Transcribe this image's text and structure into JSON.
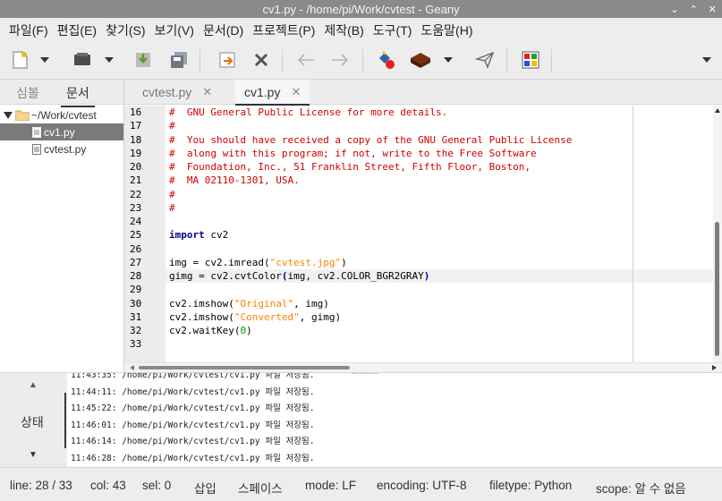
{
  "window": {
    "title": "cv1.py - /home/pi/Work/cvtest - Geany",
    "minimize": "⌄",
    "maximize": "⌃",
    "close": "✕"
  },
  "menu": [
    "파일(F)",
    "편집(E)",
    "찾기(S)",
    "보기(V)",
    "문서(D)",
    "프로젝트(P)",
    "제작(B)",
    "도구(T)",
    "도움말(H)"
  ],
  "toolbar": {
    "icons": [
      "new-file-icon",
      "open-file-icon",
      "save-icon",
      "save-all-icon",
      "revert-icon",
      "close-icon",
      "back-arrow-icon",
      "forward-arrow-icon",
      "compile-icon",
      "build-icon",
      "execute-icon",
      "color-chooser-icon",
      "overflow-arrow-icon"
    ]
  },
  "sidebar": {
    "tabs": [
      "심볼",
      "문서"
    ],
    "active_tab": "문서",
    "folder": "~/Work/cvtest",
    "files": [
      "cv1.py",
      "cvtest.py"
    ],
    "selected_file": "cv1.py"
  },
  "editor": {
    "tabs": [
      {
        "label": "cvtest.py",
        "close": "✕"
      },
      {
        "label": "cv1.py",
        "close": "✕"
      }
    ],
    "active_tab": "cv1.py",
    "lines": [
      {
        "n": "16",
        "segs": [
          {
            "t": "#  GNU General Public License for more details.",
            "c": "cm"
          }
        ]
      },
      {
        "n": "17",
        "segs": [
          {
            "t": "#",
            "c": "cm"
          }
        ]
      },
      {
        "n": "18",
        "segs": [
          {
            "t": "#  You should have received a copy of the GNU General Public License",
            "c": "cm"
          }
        ]
      },
      {
        "n": "19",
        "segs": [
          {
            "t": "#  along with this program; if not, write to the Free Software",
            "c": "cm"
          }
        ]
      },
      {
        "n": "20",
        "segs": [
          {
            "t": "#  Foundation, Inc., 51 Franklin Street, Fifth Floor, Boston,",
            "c": "cm"
          }
        ]
      },
      {
        "n": "21",
        "segs": [
          {
            "t": "#  MA 02110-1301, USA.",
            "c": "cm"
          }
        ]
      },
      {
        "n": "22",
        "segs": [
          {
            "t": "#",
            "c": "cm"
          }
        ]
      },
      {
        "n": "23",
        "segs": [
          {
            "t": "#",
            "c": "cm"
          }
        ]
      },
      {
        "n": "24",
        "segs": []
      },
      {
        "n": "25",
        "segs": [
          {
            "t": "import",
            "c": "kw"
          },
          {
            "t": " cv2",
            "c": ""
          }
        ]
      },
      {
        "n": "26",
        "segs": []
      },
      {
        "n": "27",
        "segs": [
          {
            "t": "img = cv2.imread(",
            "c": ""
          },
          {
            "t": "\"cvtest.jpg\"",
            "c": "str"
          },
          {
            "t": ")",
            "c": ""
          }
        ]
      },
      {
        "n": "28",
        "segs": [
          {
            "t": "gimg = cv2.cvtColor",
            "c": ""
          },
          {
            "t": "(",
            "c": "kw"
          },
          {
            "t": "img, cv2.COLOR_BGR2GRAY",
            "c": ""
          },
          {
            "t": ")",
            "c": "kw"
          }
        ],
        "current": true
      },
      {
        "n": "29",
        "segs": []
      },
      {
        "n": "30",
        "segs": [
          {
            "t": "cv2.imshow(",
            "c": ""
          },
          {
            "t": "\"Original\"",
            "c": "str"
          },
          {
            "t": ", img)",
            "c": ""
          }
        ]
      },
      {
        "n": "31",
        "segs": [
          {
            "t": "cv2.imshow(",
            "c": ""
          },
          {
            "t": "\"Converted\"",
            "c": "str"
          },
          {
            "t": ", gimg)",
            "c": ""
          }
        ]
      },
      {
        "n": "32",
        "segs": [
          {
            "t": "cv2.waitKey(",
            "c": ""
          },
          {
            "t": "0",
            "c": "num"
          },
          {
            "t": ")",
            "c": ""
          }
        ]
      },
      {
        "n": "33",
        "segs": []
      }
    ]
  },
  "messages": {
    "panel_label": "상태",
    "up_arrow": "▲",
    "down_arrow": "▼",
    "lines": [
      "11:43:35: /home/pi/Work/cvtest/cv1.py 파일 저장됨.",
      "11:44:11: /home/pi/Work/cvtest/cv1.py 파일 저장됨.",
      "11:45:22: /home/pi/Work/cvtest/cv1.py 파일 저장됨.",
      "11:46:01: /home/pi/Work/cvtest/cv1.py 파일 저장됨.",
      "11:46:14: /home/pi/Work/cvtest/cv1.py 파일 저장됨.",
      "11:46:28: /home/pi/Work/cvtest/cv1.py 파일 저장됨."
    ]
  },
  "status": {
    "line": "line: 28 / 33",
    "col": "col: 43",
    "sel": "sel: 0",
    "insert": "삽입",
    "indent": "스페이스",
    "mode": "mode: LF",
    "encoding": "encoding: UTF-8",
    "filetype": "filetype: Python",
    "scope": "scope: 알 수 없음"
  }
}
